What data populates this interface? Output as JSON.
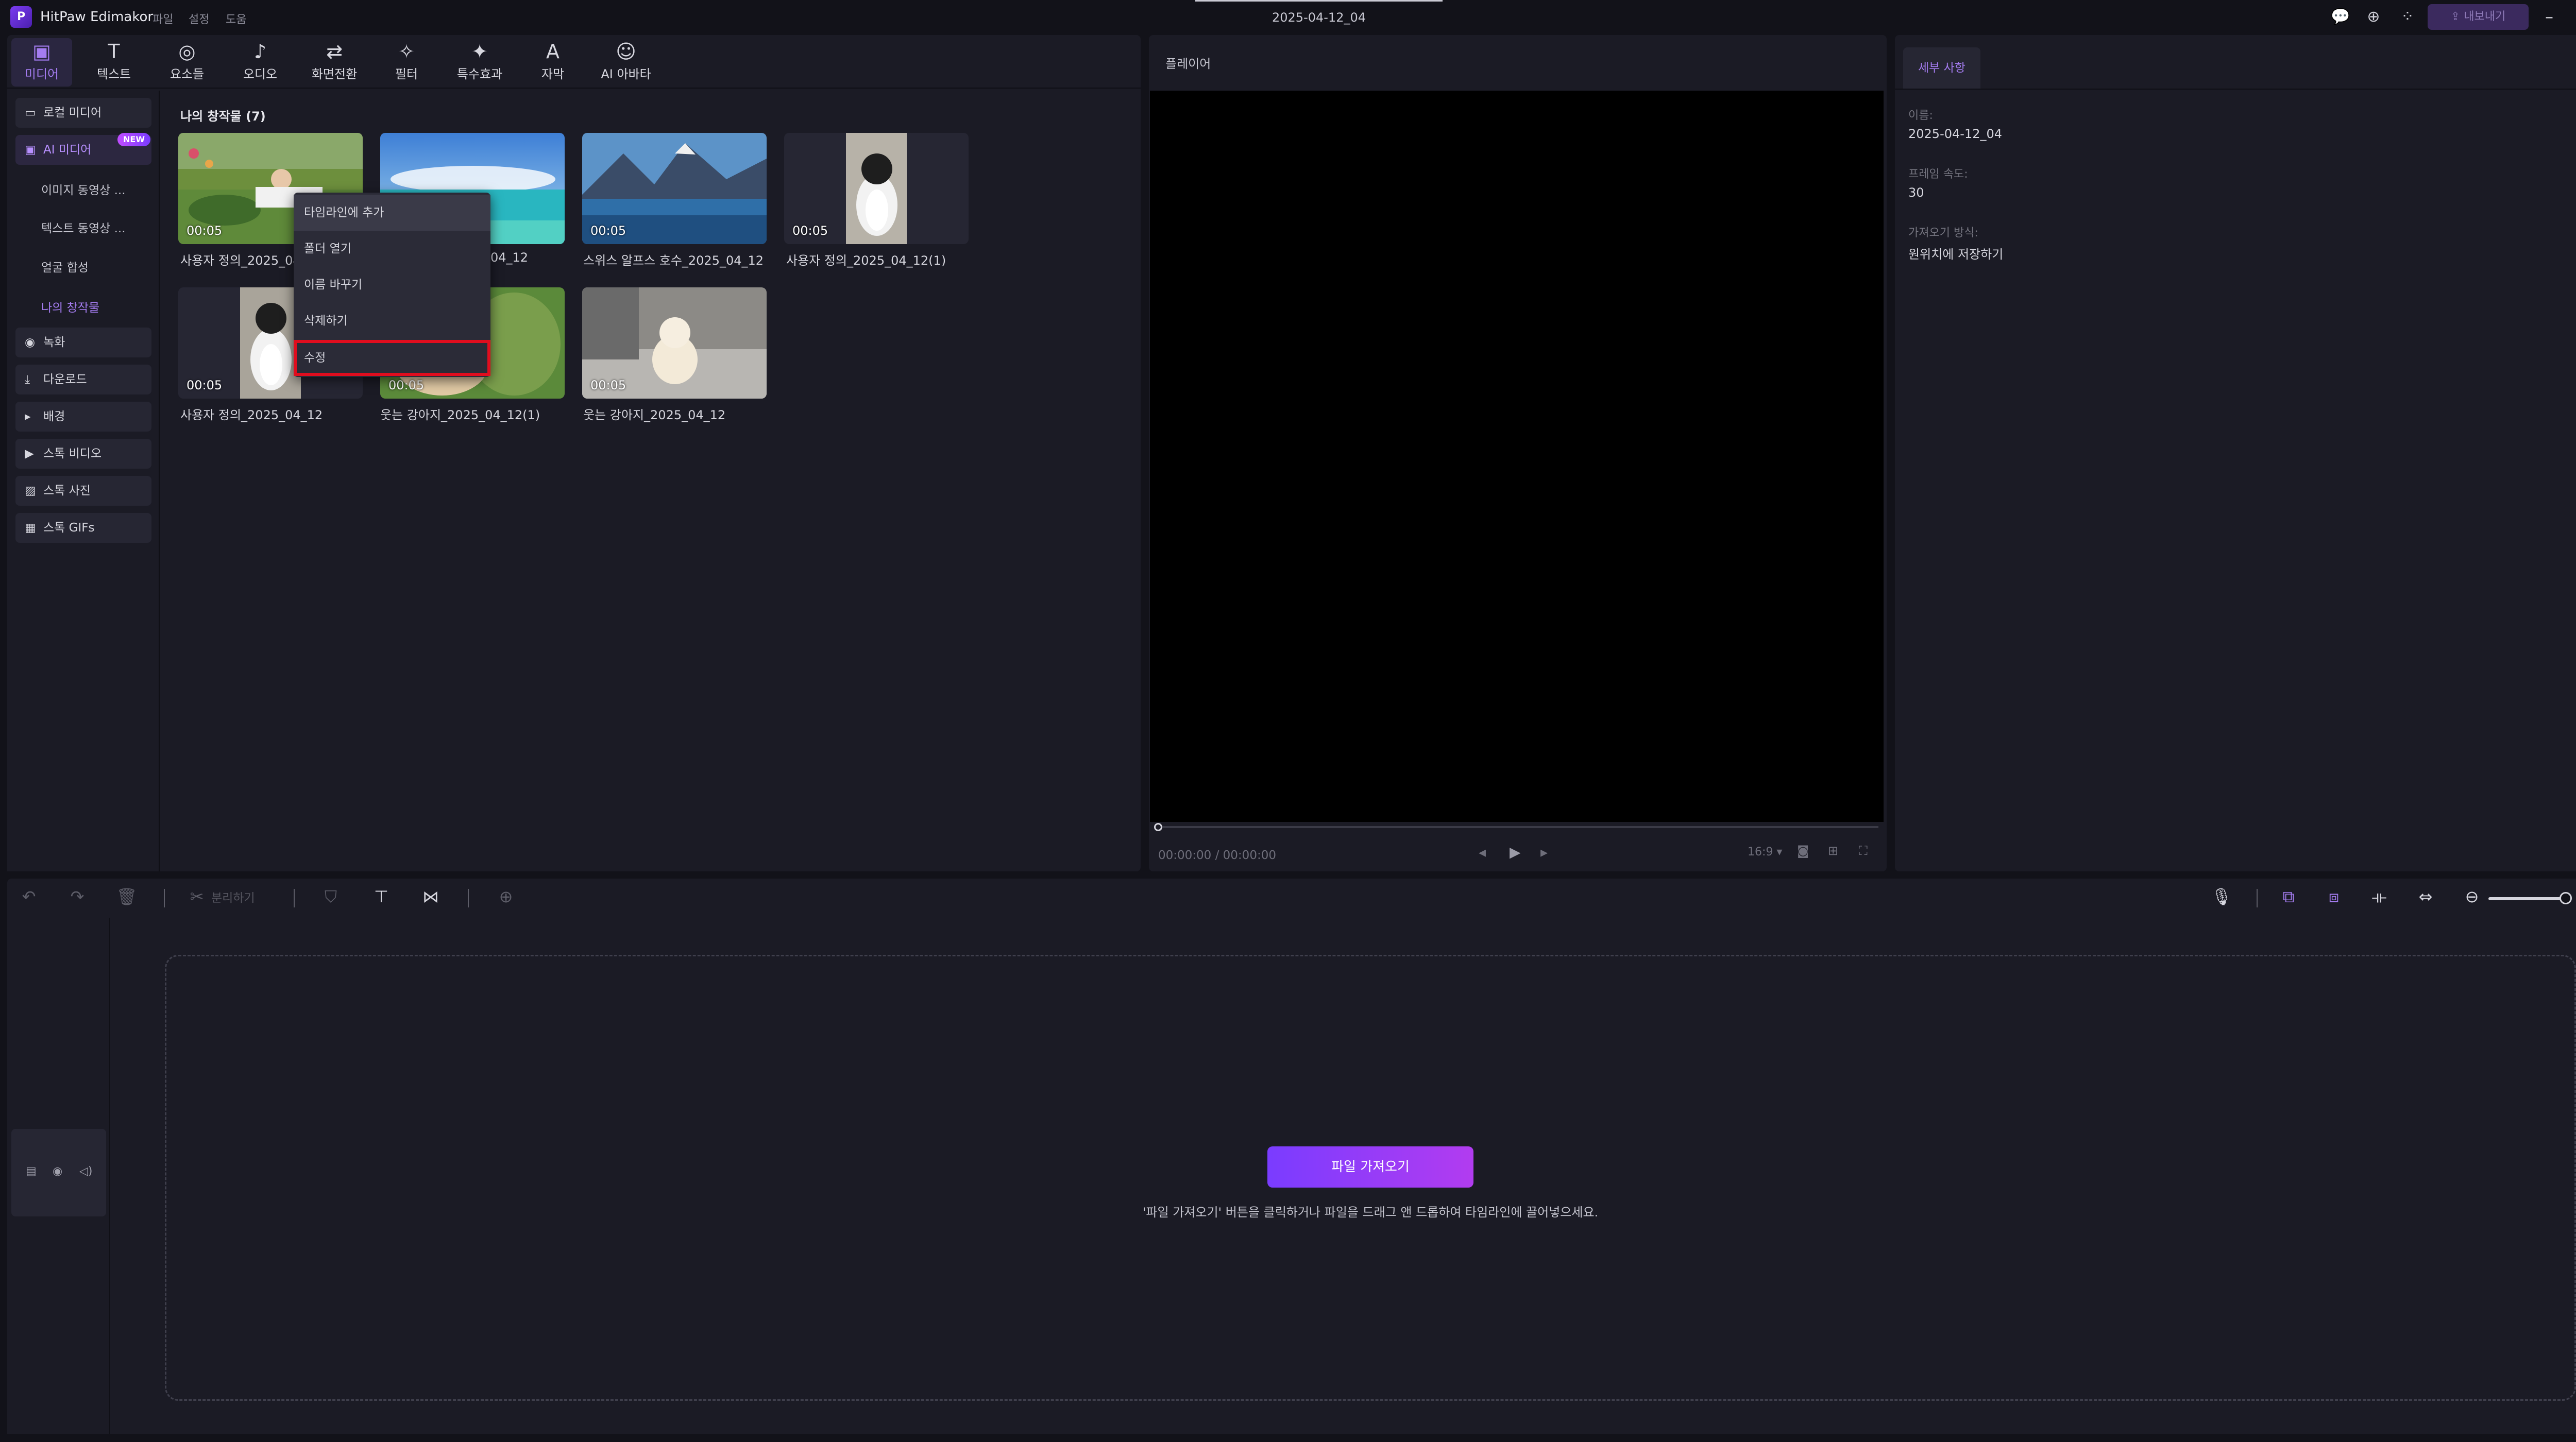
{
  "app": {
    "name": "HitPaw Edimakor",
    "logo_glyph": "P",
    "menu": [
      "파일",
      "설정",
      "도움"
    ],
    "doc_title": "2025-04-12_04",
    "export_label": "내보내기"
  },
  "media_tabs": [
    {
      "label": "미디어",
      "icon": "media-icon"
    },
    {
      "label": "텍스트",
      "icon": "text-icon"
    },
    {
      "label": "요소들",
      "icon": "elements-icon"
    },
    {
      "label": "오디오",
      "icon": "audio-icon"
    },
    {
      "label": "화면전환",
      "icon": "transition-icon"
    },
    {
      "label": "필터",
      "icon": "filter-icon"
    },
    {
      "label": "특수효과",
      "icon": "effects-icon"
    },
    {
      "label": "자막",
      "icon": "subtitle-icon"
    },
    {
      "label": "AI 아바타",
      "icon": "avatar-icon"
    }
  ],
  "sidebar": {
    "local_media": "로컬 미디어",
    "ai_media": "AI 미디어",
    "new_badge": "NEW",
    "sub_items": [
      "이미지 동영상 ...",
      "텍스트 동영상 ...",
      "얼굴 합성",
      "나의 창작물"
    ],
    "record": "녹화",
    "download": "다운로드",
    "background": "배경",
    "stock_video": "스톡 비디오",
    "stock_photo": "스톡 사진",
    "stock_gifs": "스톡 GIFs"
  },
  "library": {
    "section_title": "나의 창작물 (7)",
    "items": [
      {
        "label": "사용자 정의_2025_04",
        "duration": "00:05"
      },
      {
        "label": "04_12",
        "duration": ""
      },
      {
        "label": "스위스 알프스 호수_2025_04_12",
        "duration": "00:05"
      },
      {
        "label": "사용자 정의_2025_04_12(1)",
        "duration": "00:05"
      },
      {
        "label": "사용자 정의_2025_04_12",
        "duration": "00:05"
      },
      {
        "label": "웃는 강아지_2025_04_12(1)",
        "duration": "00:05"
      },
      {
        "label": "웃는 강아지_2025_04_12",
        "duration": "00:05"
      }
    ]
  },
  "context_menu": {
    "items": [
      "타임라인에 추가",
      "폴더 열기",
      "이름 바꾸기",
      "삭제하기",
      "수정"
    ]
  },
  "player": {
    "title": "플레이어",
    "time": "00:00:00 / 00:00:00",
    "aspect": "16:9 ▾"
  },
  "details": {
    "tab": "세부 사항",
    "name_label": "이름:",
    "name_value": "2025-04-12_04",
    "fps_label": "프레임 속도:",
    "fps_value": "30",
    "import_label": "가져오기 방식:",
    "import_value": "원위치에 저장하기"
  },
  "timeline": {
    "split_label": "분리하기",
    "import_button": "파일 가져오기",
    "hint": "'파일 가져오기' 버튼을 클릭하거나 파일을 드래그 앤 드롭하여 타임라인에 끌어넣으세요."
  }
}
